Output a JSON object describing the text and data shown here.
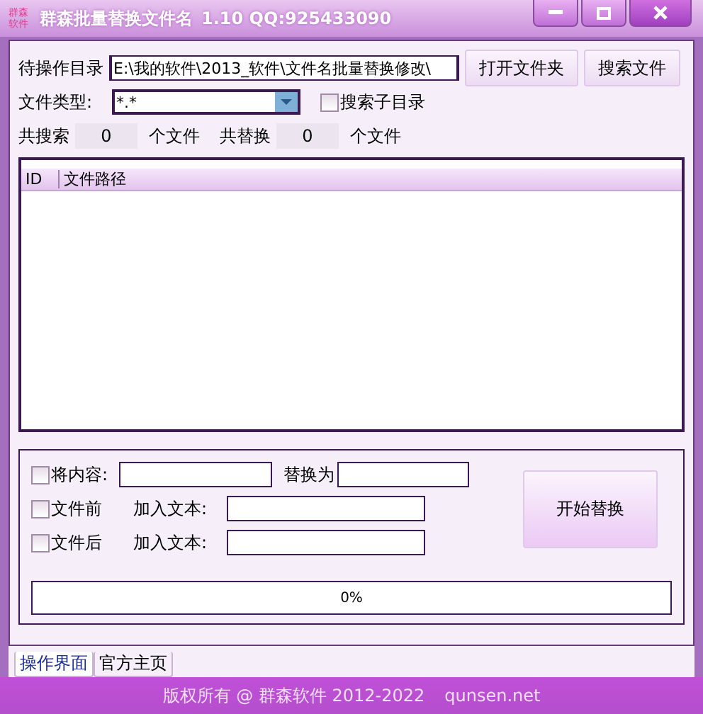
{
  "window": {
    "logo": [
      "群森",
      "软件"
    ],
    "title": "群森批量替换文件名",
    "version": "1.10 QQ:925433090"
  },
  "directory": {
    "label": "待操作目录",
    "value": "E:\\我的软件\\2013_软件\\文件名批量替换修改\\"
  },
  "buttons": [
    {
      "label": "打开文件夹"
    },
    {
      "label": "搜索文件"
    }
  ],
  "file_type": {
    "label": "文件类型:",
    "value": "*.*"
  },
  "search_subdirs": {
    "label": "搜索子目录",
    "checked": false
  },
  "counts": [
    {
      "label": "共搜索",
      "value": "0",
      "unit": "个文件"
    },
    {
      "label": "共替换",
      "value": "0",
      "unit": "个文件"
    }
  ],
  "table": {
    "columns": [
      "ID",
      "文件路径"
    ]
  },
  "options": [
    {
      "label": "将内容:",
      "checked": false,
      "kind": "replace",
      "with_label": "替换为"
    },
    {
      "label": "文件前",
      "checked": false,
      "kind": "add",
      "field_label": "加入文本:"
    },
    {
      "label": "文件后",
      "checked": false,
      "kind": "add",
      "field_label": "加入文本:"
    }
  ],
  "start_button": {
    "label": "开始替换"
  },
  "progress": {
    "level": 0,
    "reading": "0%"
  },
  "tabs": [
    {
      "label": "操作界面",
      "selected": true
    },
    {
      "label": "官方主页",
      "selected": false
    }
  ],
  "status_bar": {
    "copyright": "版权所有 @ 群森软件 2012-2022",
    "site": "qunsen.net"
  }
}
